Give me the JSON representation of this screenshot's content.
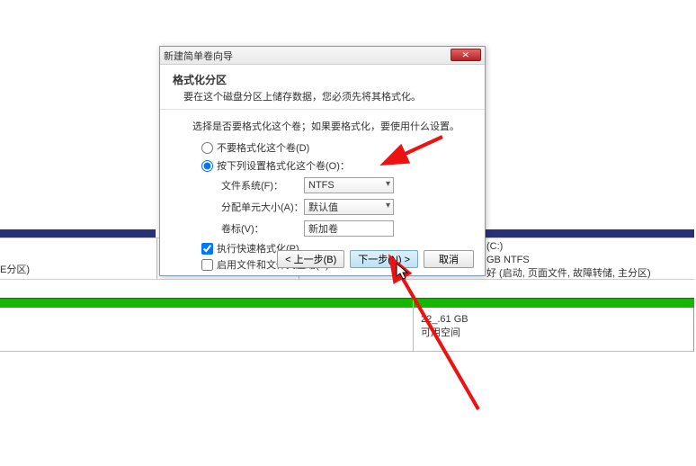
{
  "dialog": {
    "title": "新建简单卷向导",
    "heading": "格式化分区",
    "subtext": "要在这个磁盘分区上储存数据，您必须先将其格式化。",
    "instruction": "选择是否要格式化这个卷；如果要格式化，要使用什么设置。",
    "opt_noformat": "不要格式化这个卷(D)",
    "opt_format": "按下列设置格式化这个卷(O)：",
    "labels": {
      "fs": "文件系统(F)：",
      "alloc": "分配单元大小(A)：",
      "vol": "卷标(V)："
    },
    "values": {
      "fs": "NTFS",
      "alloc": "默认值",
      "vol": "新加卷"
    },
    "chk_quick": "执行快速格式化(P)",
    "chk_compress": "启用文件和文件夹压缩(E)",
    "buttons": {
      "back": "< 上一步(B)",
      "next": "下一步(N) >",
      "cancel": "取消"
    }
  },
  "bg": {
    "partlabel": "E分区)",
    "cdrive": "(C:)",
    "csize": "GB NTFS",
    "cstatus": "好 (启动, 页面文件, 故障转储, 主分区)",
    "freesize": "22_.61 GB",
    "freetext": "可用空间"
  }
}
